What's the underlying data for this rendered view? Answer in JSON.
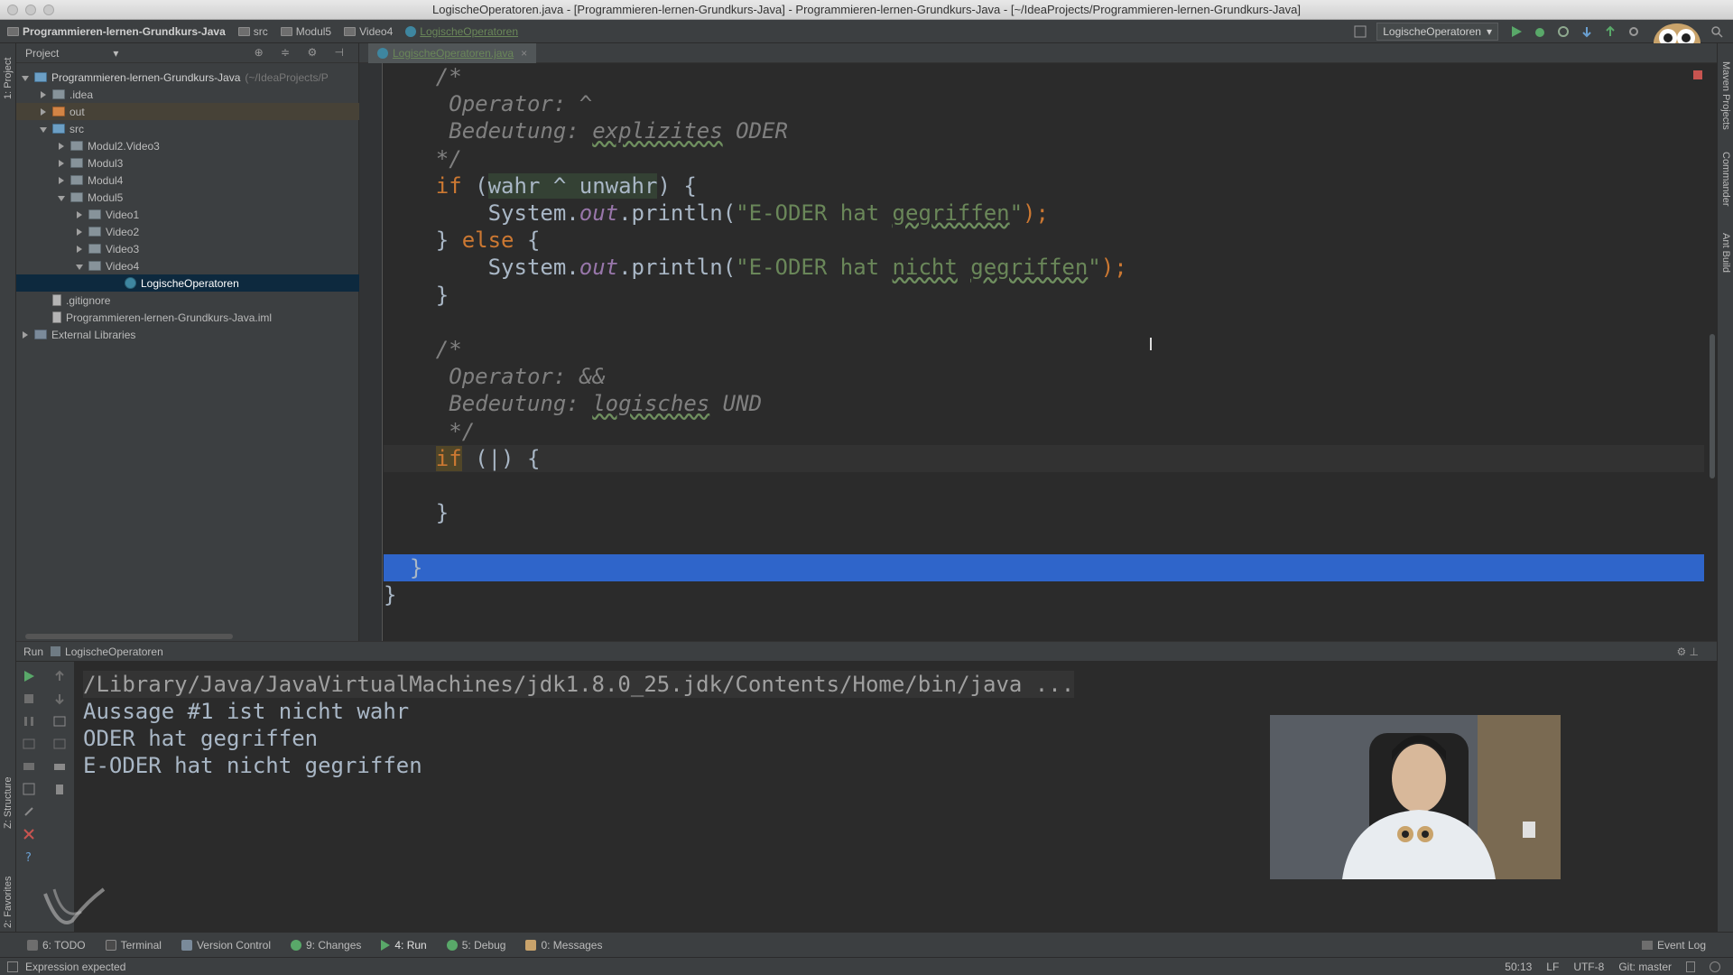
{
  "window": {
    "title": "LogischeOperatoren.java - [Programmieren-lernen-Grundkurs-Java] - Programmieren-lernen-Grundkurs-Java - [~/IdeaProjects/Programmieren-lernen-Grundkurs-Java]"
  },
  "navbar": {
    "crumbs": [
      "Programmieren-lernen-Grundkurs-Java",
      "src",
      "Modul5",
      "Video4",
      "LogischeOperatoren"
    ],
    "run_config": "LogischeOperatoren"
  },
  "left_strip": {
    "project_label": "1: Project",
    "structure_label": "Z: Structure",
    "favorites_label": "2: Favorites"
  },
  "right_strip": {
    "maven_label": "Maven Projects",
    "commander_label": "Commander",
    "ant_label": "Ant Build"
  },
  "project": {
    "header": "Project",
    "tree": [
      {
        "label": "Programmieren-lernen-Grundkurs-Java",
        "hint": "(~/IdeaProjects/P",
        "depth": 0,
        "arrow": "d",
        "icon": "blue"
      },
      {
        "label": ".idea",
        "depth": 1,
        "arrow": "r",
        "icon": "folder"
      },
      {
        "label": "out",
        "depth": 1,
        "arrow": "r",
        "icon": "orange",
        "highlight": "out"
      },
      {
        "label": "src",
        "depth": 1,
        "arrow": "d",
        "icon": "blue"
      },
      {
        "label": "Modul2.Video3",
        "depth": 2,
        "arrow": "r",
        "icon": "folder"
      },
      {
        "label": "Modul3",
        "depth": 2,
        "arrow": "r",
        "icon": "folder"
      },
      {
        "label": "Modul4",
        "depth": 2,
        "arrow": "r",
        "icon": "folder"
      },
      {
        "label": "Modul5",
        "depth": 2,
        "arrow": "d",
        "icon": "folder"
      },
      {
        "label": "Video1",
        "depth": 3,
        "arrow": "r",
        "icon": "folder"
      },
      {
        "label": "Video2",
        "depth": 3,
        "arrow": "r",
        "icon": "folder"
      },
      {
        "label": "Video3",
        "depth": 3,
        "arrow": "r",
        "icon": "folder"
      },
      {
        "label": "Video4",
        "depth": 3,
        "arrow": "d",
        "icon": "folder"
      },
      {
        "label": "LogischeOperatoren",
        "depth": 5,
        "arrow": "n",
        "icon": "cls",
        "highlight": "sel"
      },
      {
        "label": ".gitignore",
        "depth": 1,
        "arrow": "n",
        "icon": "file"
      },
      {
        "label": "Programmieren-lernen-Grundkurs-Java.iml",
        "depth": 1,
        "arrow": "n",
        "icon": "file"
      },
      {
        "label": "External Libraries",
        "depth": 0,
        "arrow": "r",
        "icon": "lib"
      }
    ]
  },
  "editor": {
    "tab_label": "LogischeOperatoren.java",
    "lines": [
      [
        {
          "t": "    /*",
          "c": "cm"
        }
      ],
      [
        {
          "t": "     Operator: ^",
          "c": "cm"
        }
      ],
      [
        {
          "t": "     Bedeutung: ",
          "c": "cm"
        },
        {
          "t": "explizites",
          "c": "cm ul"
        },
        {
          "t": " ODER",
          "c": "cm"
        }
      ],
      [
        {
          "t": "    */",
          "c": "cm"
        }
      ],
      [
        {
          "t": "    ",
          "c": ""
        },
        {
          "t": "if",
          "c": "kw"
        },
        {
          "t": " (",
          "c": ""
        },
        {
          "t": "wahr ^ unwahr",
          "c": "hl"
        },
        {
          "t": ") {",
          "c": ""
        }
      ],
      [
        {
          "t": "        System.",
          "c": ""
        },
        {
          "t": "out",
          "c": "fld"
        },
        {
          "t": ".println(",
          "c": ""
        },
        {
          "t": "\"E-ODER hat ",
          "c": "str"
        },
        {
          "t": "gegriffen",
          "c": "str ul"
        },
        {
          "t": "\"",
          "c": "str"
        },
        {
          "t": ");",
          "c": "kw"
        }
      ],
      [
        {
          "t": "    } ",
          "c": ""
        },
        {
          "t": "else",
          "c": "kw"
        },
        {
          "t": " {",
          "c": ""
        }
      ],
      [
        {
          "t": "        System.",
          "c": ""
        },
        {
          "t": "out",
          "c": "fld"
        },
        {
          "t": ".println(",
          "c": ""
        },
        {
          "t": "\"E-ODER hat ",
          "c": "str"
        },
        {
          "t": "nicht",
          "c": "str ul"
        },
        {
          "t": " ",
          "c": "str"
        },
        {
          "t": "gegriffen",
          "c": "str ul"
        },
        {
          "t": "\"",
          "c": "str"
        },
        {
          "t": ");",
          "c": "kw"
        }
      ],
      [
        {
          "t": "    }",
          "c": ""
        }
      ],
      [
        {
          "t": "",
          "c": ""
        }
      ],
      [
        {
          "t": "    /*",
          "c": "cm"
        }
      ],
      [
        {
          "t": "     Operator: &&",
          "c": "cm"
        }
      ],
      [
        {
          "t": "     Bedeutung: ",
          "c": "cm"
        },
        {
          "t": "logisches",
          "c": "cm ul"
        },
        {
          "t": " UND",
          "c": "cm"
        }
      ],
      [
        {
          "t": "     */",
          "c": "cm"
        }
      ],
      [
        {
          "t": "    ",
          "c": ""
        },
        {
          "t": "if",
          "c": "kw kwbg"
        },
        {
          "t": " (|) {",
          "c": ""
        }
      ],
      [
        {
          "t": "",
          "c": ""
        }
      ],
      [
        {
          "t": "    }",
          "c": ""
        }
      ],
      [
        {
          "t": "",
          "c": ""
        }
      ],
      [
        {
          "t": "  }",
          "c": ""
        }
      ],
      [
        {
          "t": "}",
          "c": ""
        }
      ]
    ]
  },
  "run": {
    "header_label": "Run",
    "config_name": "LogischeOperatoren",
    "console": [
      "/Library/Java/JavaVirtualMachines/jdk1.8.0_25.jdk/Contents/Home/bin/java ...",
      "Aussage #1 ist nicht wahr",
      "ODER hat gegriffen",
      "E-ODER hat nicht gegriffen"
    ]
  },
  "bottom_tabs": [
    "6: TODO",
    "Terminal",
    "Version Control",
    "9: Changes",
    "4: Run",
    "5: Debug",
    "0: Messages"
  ],
  "event_log": "Event Log",
  "status": {
    "message": "Expression expected",
    "position": "50:13",
    "line_sep": "LF",
    "encoding": "UTF-8",
    "git": "Git: master"
  },
  "colors": {
    "accent_selection": "#2f65ca",
    "keyword": "#cc7832",
    "string": "#6a8759",
    "comment": "#808080",
    "field": "#9876aa"
  }
}
